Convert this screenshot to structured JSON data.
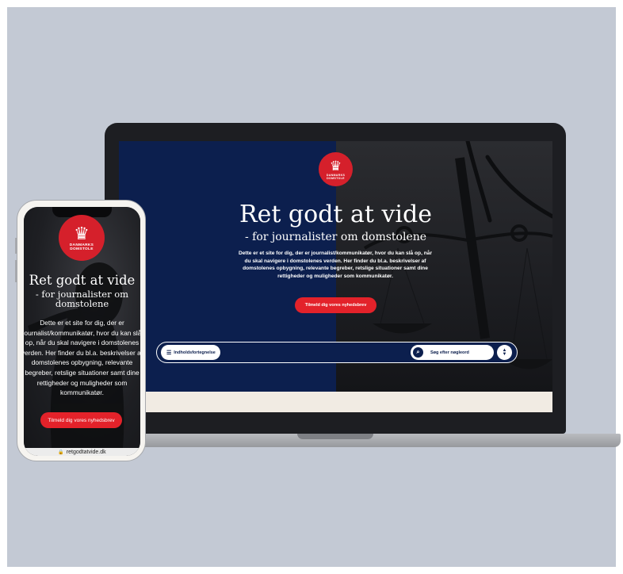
{
  "site": {
    "seal_text": "DANMARKS DOMSTOLE",
    "crown_icon": "crown-icon",
    "hero_title": "Ret godt at vide",
    "hero_subtitle": "- for journalister om domstolene",
    "hero_body": "Dette er et site for dig, der er journalist/kommunikatør, hvor du kan slå op, når du skal navigere i domstolenes verden. Her finder du bl.a. beskrivelser af domstolenes opbygning, relevante begreber, retslige situationer samt dine rettigheder og muligheder som kommunikatør.",
    "cta_label": "Tilmeld dig vores nyhedsbrev",
    "nav": {
      "toc_label": "Indholdsfortegnelse",
      "search_placeholder": "Søg efter nøgleord"
    }
  },
  "phone": {
    "subtitle_line1": "- for journalister om",
    "subtitle_line2": "domstolene",
    "url": "retgodtatvide.dk"
  },
  "colors": {
    "navy": "#0c1f4e",
    "accent_red": "#e3222a",
    "background": "#c3c9d4"
  }
}
